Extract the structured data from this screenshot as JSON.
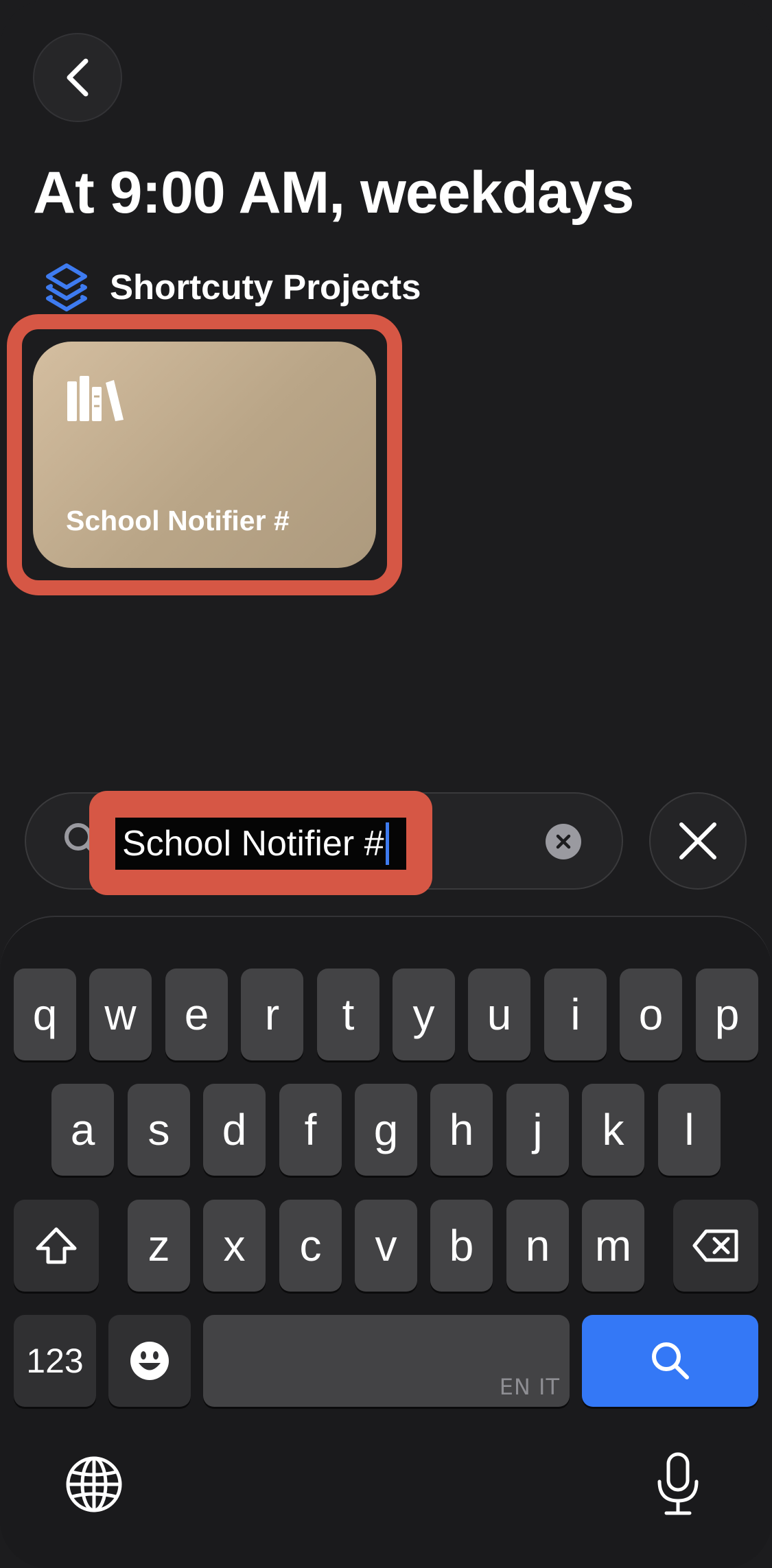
{
  "header": {
    "back_icon": "chevron-left-icon",
    "title": "At 9:00 AM, weekdays"
  },
  "folder": {
    "icon": "layers-icon",
    "label": "Shortcuty Projects",
    "accent": "#3e7bf0"
  },
  "shortcut_card": {
    "icon": "books-icon",
    "label": "School Notifier #",
    "color": "#c4b092"
  },
  "search": {
    "icon": "search-icon",
    "value": "School Notifier #",
    "clear_icon": "clear-circle-icon",
    "close_icon": "close-icon"
  },
  "highlight_color": "#d65745",
  "keyboard": {
    "row1": [
      "q",
      "w",
      "e",
      "r",
      "t",
      "y",
      "u",
      "i",
      "o",
      "p"
    ],
    "row2": [
      "a",
      "s",
      "d",
      "f",
      "g",
      "h",
      "j",
      "k",
      "l"
    ],
    "row3": [
      "z",
      "x",
      "c",
      "v",
      "b",
      "n",
      "m"
    ],
    "numbers_label": "123",
    "space_lang_label": "EN IT",
    "shift_icon": "shift-icon",
    "delete_icon": "delete-backward-icon",
    "emoji_icon": "emoji-icon",
    "search_key_icon": "search-icon",
    "globe_icon": "globe-icon",
    "mic_icon": "microphone-icon",
    "search_key_color": "#3478f6"
  }
}
